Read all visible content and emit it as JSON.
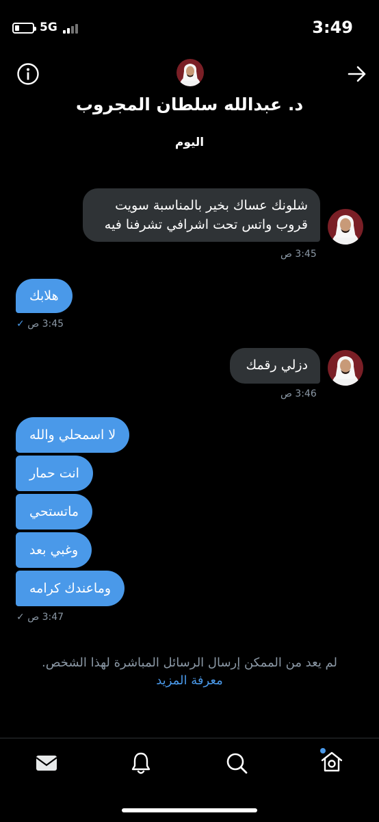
{
  "status_bar": {
    "network": "5G",
    "time": "3:49"
  },
  "header": {
    "contact_name": "د. عبدالله سلطان المجروب",
    "info_icon": "info-circle-icon",
    "forward_icon": "arrow-right-icon"
  },
  "conversation": {
    "day_label": "اليوم",
    "messages": [
      {
        "direction": "incoming",
        "text": "شلونك عساك بخير بالمناسبة سويت قروب واتس تحت اشرافي تشرفنا فيه",
        "lines": [
          "شلونك عساك بخير بالمناسبة سويت",
          "قروب واتس تحت اشرافي تشرفنا فيه"
        ],
        "time": "3:45 ص"
      },
      {
        "direction": "outgoing",
        "text": "هلابك",
        "time": "3:45 ص"
      },
      {
        "direction": "incoming",
        "text": "دزلي رقمك",
        "time": "3:46 ص"
      },
      {
        "direction": "outgoing",
        "text": "لا اسمحلي والله"
      },
      {
        "direction": "outgoing",
        "text": "انت حمار"
      },
      {
        "direction": "outgoing",
        "text": "ماتستحي"
      },
      {
        "direction": "outgoing",
        "text": "وغبي بعد"
      },
      {
        "direction": "outgoing",
        "text": "وماعندك كرامه",
        "time": "3:47 ص"
      }
    ]
  },
  "notice": {
    "text": "لم يعد من الممكن إرسال الرسائل المباشرة لهذا الشخص.",
    "link": "معرفة المزيد"
  },
  "tab_bar": {
    "items": [
      "mail-icon",
      "bell-icon",
      "search-icon",
      "home-icon"
    ]
  },
  "colors": {
    "background": "#000000",
    "outgoing_bubble": "#4a99e9",
    "incoming_bubble": "#2f3336",
    "link": "#4a99e9",
    "muted_text": "#8b98a5"
  }
}
